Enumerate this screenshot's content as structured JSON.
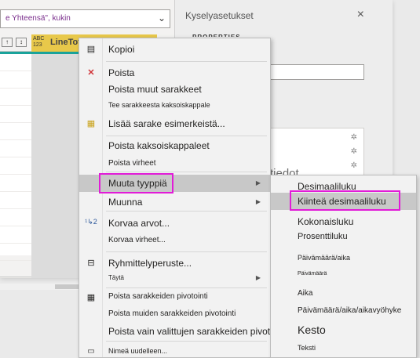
{
  "formula_bar": {
    "text": "e Yhteensä\", kukin",
    "chevron": "chevron-down-icon"
  },
  "grid": {
    "column_type": "ABC\n123",
    "column_name": "LineTot",
    "row_count": 13
  },
  "query_settings": {
    "title": "Kyselyasetukset",
    "close": "×",
    "properties_label": "PROPERTIES",
    "steps_label": "tiedot"
  },
  "context_menu": {
    "items": [
      {
        "label": "Kopioi",
        "icon": "copy-icon"
      },
      {
        "label": "Poista",
        "icon": "delete-icon"
      },
      {
        "label": "Poista muut sarakkeet"
      },
      {
        "label": "Tee sarakkeesta kaksoiskappale"
      },
      {
        "label": "Lisää sarake esimerkeistä...",
        "icon": "column-from-examples-icon"
      },
      {
        "label": "Poista kaksoiskappaleet"
      },
      {
        "label": "Poista virheet"
      },
      {
        "label": "Muuta tyyppiä"
      },
      {
        "label": "Muunna"
      },
      {
        "label": "Korvaa arvot...",
        "icon": "replace-values-icon"
      },
      {
        "label": "Korvaa virheet..."
      },
      {
        "label": "Ryhmittelyperuste...",
        "icon": "group-by-icon"
      },
      {
        "label": "Täytä"
      },
      {
        "label": "Poista sarakkeiden pivotointi",
        "icon": "unpivot-icon"
      },
      {
        "label": "Poista muiden sarakkeiden pivotointi"
      },
      {
        "label": "Poista vain valittujen sarakkeiden pivotointi"
      },
      {
        "label": "Nimeä uudelleen...",
        "icon": "rename-icon"
      }
    ],
    "highlight_color": "#e21bd8"
  },
  "type_submenu": {
    "items": [
      "Desimaaliluku",
      "Kiinteä desimaaliluku",
      "Kokonaisluku",
      "Prosenttiluku",
      "Päivämäärä/aika",
      "Päivämäärä",
      "Aika",
      "Päivämäärä/aika/aikavyöhyke",
      "Kesto",
      "Teksti"
    ]
  }
}
